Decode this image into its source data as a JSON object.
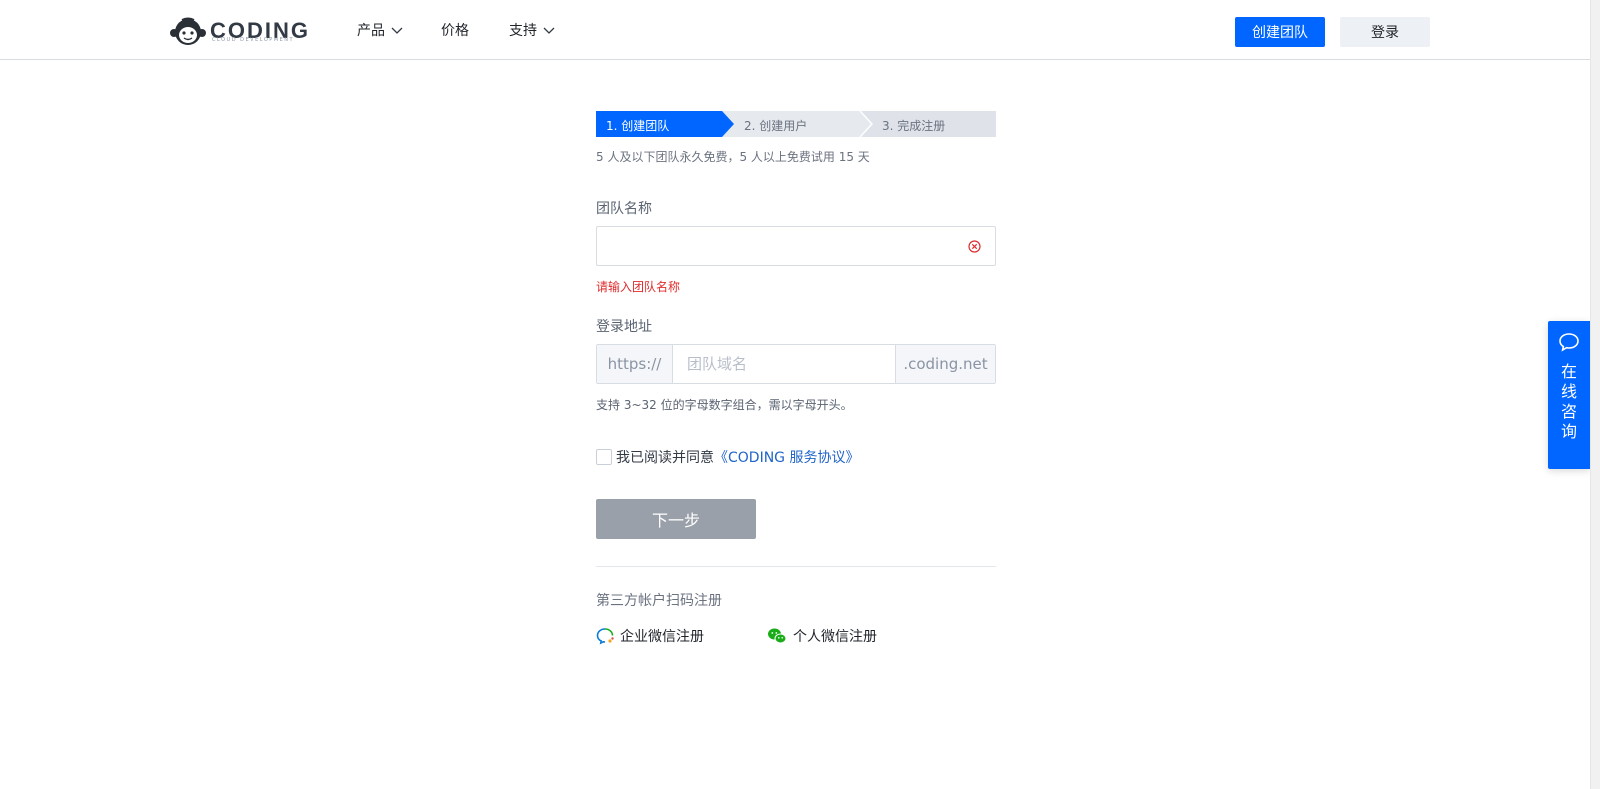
{
  "header": {
    "logo_text": "CODING",
    "logo_sub": "CLOUD DEVELOPMENT",
    "nav": [
      {
        "label": "产品",
        "has_dropdown": true
      },
      {
        "label": "价格",
        "has_dropdown": false
      },
      {
        "label": "支持",
        "has_dropdown": true
      }
    ],
    "create_team_label": "创建团队",
    "login_label": "登录"
  },
  "steps": [
    {
      "label": "1. 创建团队",
      "active": true
    },
    {
      "label": "2. 创建用户",
      "active": false
    },
    {
      "label": "3. 完成注册",
      "active": false
    }
  ],
  "hint": "5 人及以下团队永久免费，5 人以上免费试用 15 天",
  "team_name": {
    "label": "团队名称",
    "value": "",
    "error": "请输入团队名称"
  },
  "login_address": {
    "label": "登录地址",
    "prefix": "https://",
    "placeholder": "团队域名",
    "suffix": ".coding.net",
    "hint": "支持 3~32 位的字母数字组合，需以字母开头。"
  },
  "agreement": {
    "text": "我已阅读并同意",
    "link": "《CODING 服务协议》",
    "checked": false
  },
  "next_button": "下一步",
  "third_party": {
    "title": "第三方帐户扫码注册",
    "options": [
      "企业微信注册",
      "个人微信注册"
    ]
  },
  "consult": {
    "label": "在线咨询"
  },
  "colors": {
    "primary": "#0066ff",
    "error": "#e02c2c",
    "link": "#1f64c8",
    "disabled_button": "#9aa0aa",
    "wechat_green": "#1aad19"
  }
}
